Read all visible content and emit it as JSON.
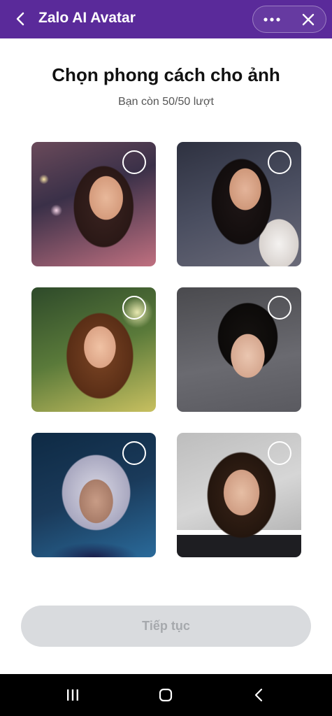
{
  "header": {
    "title": "Zalo AI Avatar",
    "back_icon": "chevron-left-icon",
    "more_icon": "more-dots-icon",
    "close_icon": "close-icon",
    "bg_color": "#5a2a9a"
  },
  "main": {
    "heading": "Chọn phong cách cho ảnh",
    "subheading": "Bạn còn 50/50 lượt",
    "styles": [
      {
        "selected": false
      },
      {
        "selected": false
      },
      {
        "selected": false
      },
      {
        "selected": false
      },
      {
        "selected": false
      },
      {
        "selected": false
      }
    ]
  },
  "footer": {
    "continue_label": "Tiếp tục",
    "continue_enabled": false
  },
  "system_nav": {
    "recents_icon": "recents-icon",
    "home_icon": "home-icon",
    "back_icon": "back-icon"
  }
}
